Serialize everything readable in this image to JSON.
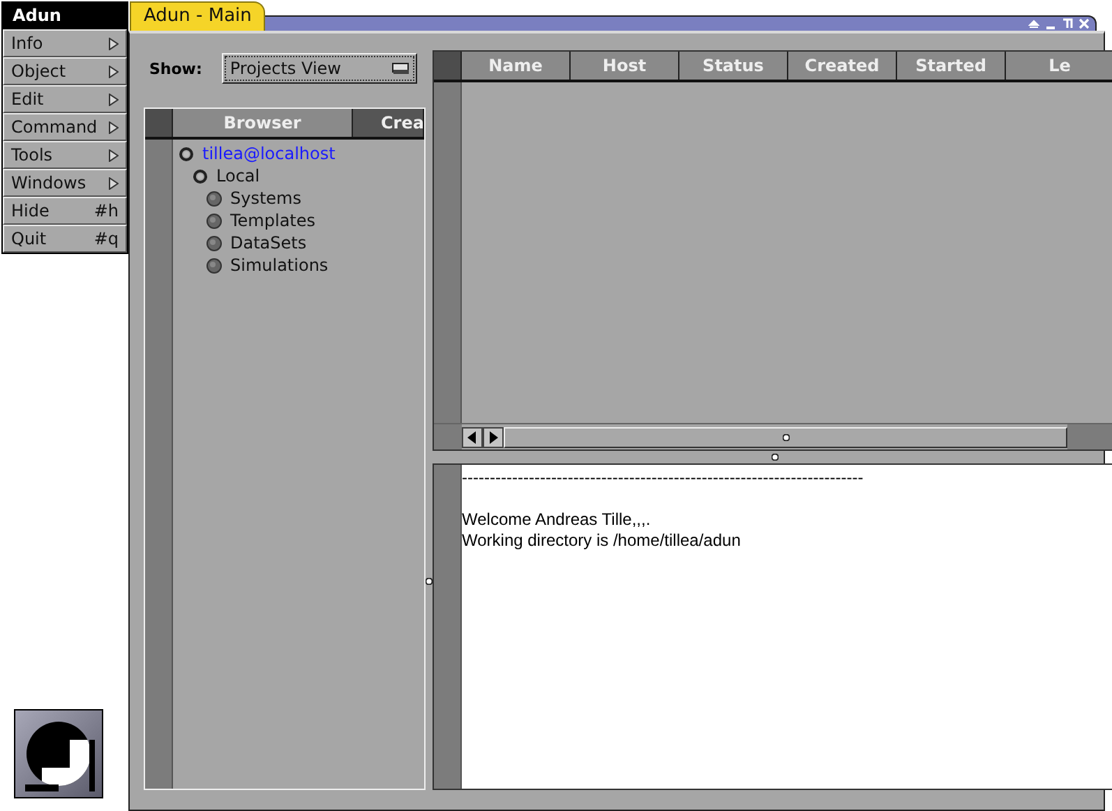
{
  "menu": {
    "title": "Adun",
    "items": [
      {
        "label": "Info",
        "kind": "submenu"
      },
      {
        "label": "Object",
        "kind": "submenu"
      },
      {
        "label": "Edit",
        "kind": "submenu"
      },
      {
        "label": "Command",
        "kind": "submenu"
      },
      {
        "label": "Tools",
        "kind": "submenu"
      },
      {
        "label": "Windows",
        "kind": "submenu"
      },
      {
        "label": "Hide",
        "kind": "shortcut",
        "shortcut": "#h"
      },
      {
        "label": "Quit",
        "kind": "shortcut",
        "shortcut": "#q"
      }
    ]
  },
  "window": {
    "title": "Adun  - Main"
  },
  "show": {
    "label": "Show:",
    "value": "Projects View"
  },
  "browser": {
    "columns": [
      {
        "label": "Browser",
        "selected": true
      },
      {
        "label": "Crea",
        "selected": false
      }
    ],
    "tree": [
      {
        "label": "tillea@localhost",
        "selected": true,
        "children": [
          {
            "label": "Local",
            "selected": false,
            "children": [
              {
                "label": "Systems",
                "selected": false
              },
              {
                "label": "Templates",
                "selected": false
              },
              {
                "label": "DataSets",
                "selected": false
              },
              {
                "label": "Simulations",
                "selected": false
              }
            ]
          }
        ]
      }
    ]
  },
  "table": {
    "columns": [
      "Name",
      "Host",
      "Status",
      "Created",
      "Started",
      "Le"
    ]
  },
  "log": {
    "lines": [
      "------------------------------------------------------------------------",
      "Welcome Andreas Tille,,,.",
      "Working directory is /home/tillea/adun"
    ]
  }
}
